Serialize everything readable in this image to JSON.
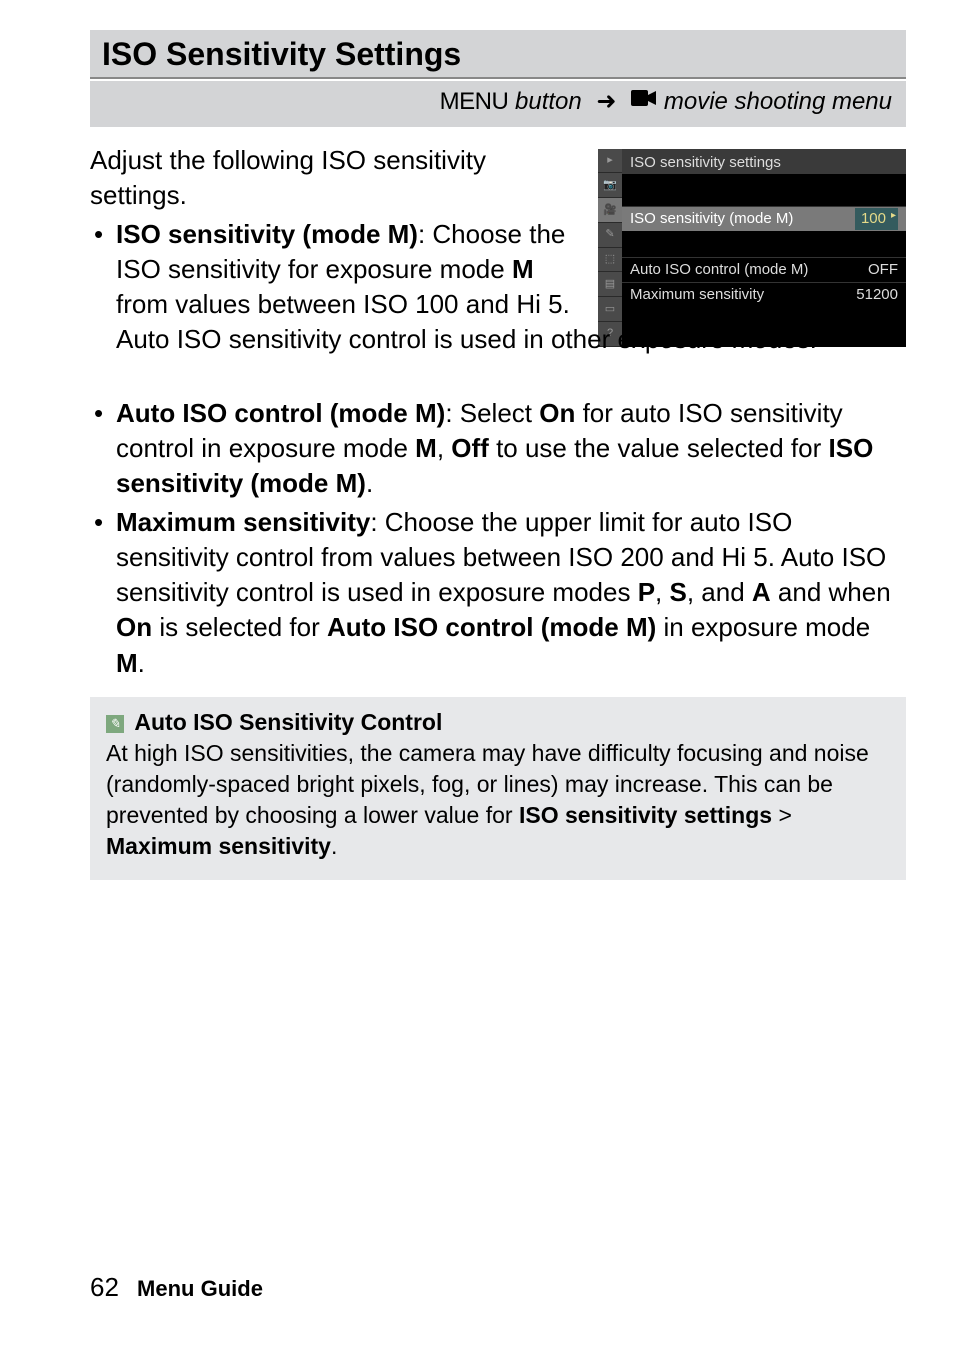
{
  "title": "ISO Sensitivity Settings",
  "breadcrumb": {
    "menu_label": "MENU",
    "button_text": "button",
    "movie_text": "movie shooting menu"
  },
  "intro": "Adjust the following ISO sensitivity settings.",
  "screenshot": {
    "header": "ISO sensitivity settings",
    "rows": [
      {
        "label": "ISO sensitivity (mode M)",
        "value": "100"
      },
      {
        "label": "Auto ISO control (mode M)",
        "value": "OFF"
      },
      {
        "label": "Maximum sensitivity",
        "value": "51200"
      }
    ]
  },
  "bullets": [
    {
      "term": "ISO sensitivity (mode M)",
      "text_before": ": Choose the ISO sensitivity for exposure mode ",
      "m1": "M",
      "text_mid": " from values between ISO 100 and Hi 5.",
      "continuation": "  Auto ISO sensitivity control is used in other exposure modes."
    },
    {
      "term": "Auto ISO control (mode M)",
      "text1": ": Select ",
      "on": "On",
      "text2": " for auto ISO sensitivity control in exposure mode ",
      "m": "M",
      "comma": ", ",
      "off": "Off",
      "text3": " to use the value selected for ",
      "iso_sens": "ISO sensitivity (mode M)",
      "period": "."
    },
    {
      "term": "Maximum sensitivity",
      "text1": ": Choose the upper limit for auto ISO sensitivity control from values between ISO 200 and Hi 5.  Auto ISO sensitivity control is used in exposure modes ",
      "p": "P",
      "c1": ", ",
      "s": "S",
      "c2": ", and ",
      "a": "A",
      "text2": " and when ",
      "on": "On",
      "text3": " is selected for ",
      "auto_iso": "Auto ISO control (mode M)",
      "text4": " in exposure mode ",
      "m": "M",
      "period": "."
    }
  ],
  "note": {
    "title": "Auto ISO Sensitivity Control",
    "text1": "At high ISO sensitivities, the camera may have difficulty focusing and noise (randomly-spaced bright pixels, fog, or lines) may increase.  This can be prevented by choosing a lower value for ",
    "bold1": "ISO sensitivity settings",
    "gt": " > ",
    "bold2": "Maximum sensitivity",
    "period": "."
  },
  "footer": {
    "page": "62",
    "label": "Menu Guide"
  }
}
